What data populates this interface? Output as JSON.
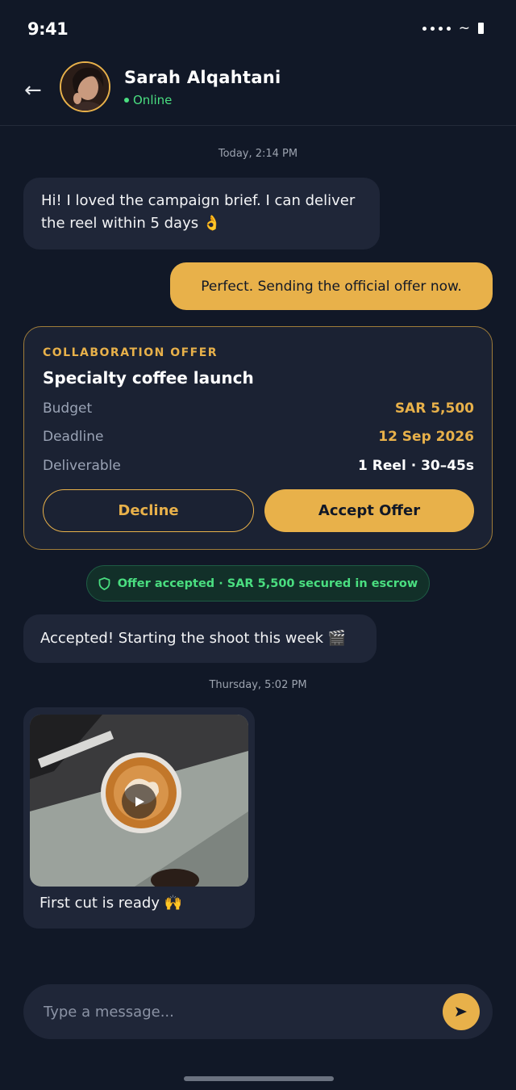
{
  "status_bar": {
    "time": "9:41"
  },
  "header": {
    "contact_name": "Sarah Alqahtani",
    "presence": "Online",
    "back_icon": "arrow-left-icon"
  },
  "messages": {
    "timestamp_1": "Today, 2:14 PM",
    "incoming_1": "Hi! I loved the campaign brief. I can deliver the reel within 5 days 👌",
    "outgoing_1": "Perfect. Sending the official offer now.",
    "incoming_2": "Accepted! Starting the shoot this week 🎬",
    "timestamp_2": "Thursday, 5:02 PM",
    "media_caption": "First cut is ready 🙌"
  },
  "offer": {
    "eyebrow": "COLLABORATION OFFER",
    "title": "Specialty coffee launch",
    "rows": [
      {
        "label": "Budget",
        "value": "SAR 5,500"
      },
      {
        "label": "Deadline",
        "value": "12 Sep 2026"
      },
      {
        "label": "Deliverable",
        "value": "1 Reel · 30–45s"
      }
    ],
    "decline_label": "Decline",
    "accept_label": "Accept Offer"
  },
  "escrow": {
    "icon": "shield-icon",
    "text": "Offer accepted · SAR 5,500 secured in escrow"
  },
  "composer": {
    "placeholder": "Type a message...",
    "send_icon": "send-icon"
  },
  "colors": {
    "background": "#111827",
    "accent": "#e8b14a",
    "bubble": "#1f2638",
    "online": "#4ade80"
  }
}
